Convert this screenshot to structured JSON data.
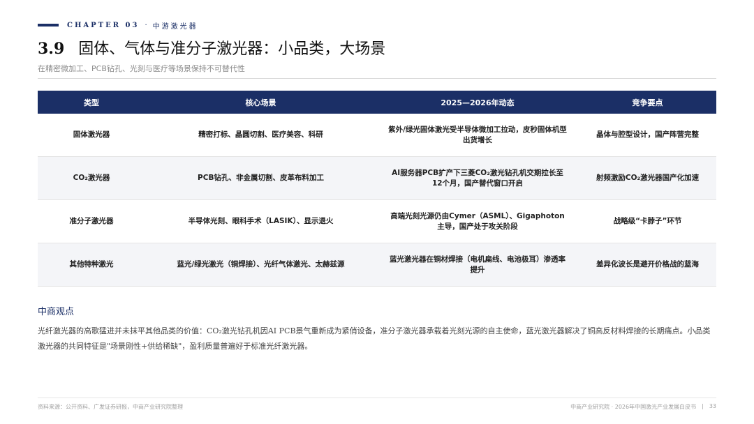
{
  "header": {
    "chapter": "CHAPTER 03",
    "chapter_sep": "·",
    "chapter_sub": "中游激光器",
    "title_num": "3.9",
    "title": "固体、气体与准分子激光器：小品类，大场景",
    "subtitle": "在精密微加工、PCB钻孔、光刻与医疗等场景保持不可替代性"
  },
  "table": {
    "headers": [
      "类型",
      "核心场景",
      "2025—2026年动态",
      "竞争要点"
    ],
    "rows": [
      [
        "固体激光器",
        "精密打标、晶圆切割、医疗美容、科研",
        "紫外/绿光固体激光受半导体微加工拉动，皮秒固体机型出货增长",
        "晶体与腔型设计，国产阵营完整"
      ],
      [
        "CO₂激光器",
        "PCB钻孔、非金属切割、皮革布料加工",
        "AI服务器PCB扩产下三菱CO₂激光钻孔机交期拉长至12个月，国产替代窗口开启",
        "射频激励CO₂激光器国产化加速"
      ],
      [
        "准分子激光器",
        "半导体光刻、眼科手术（LASIK）、显示退火",
        "高端光刻光源仍由Cymer（ASML）、Gigaphoton主导，国产处于攻关阶段",
        "战略级“卡脖子”环节"
      ],
      [
        "其他特种激光",
        "蓝光/绿光激光（铜焊接）、光纤气体激光、太赫兹源",
        "蓝光激光器在铜材焊接（电机扁线、电池极耳）渗透率提升",
        "差异化波长是避开价格战的蓝海"
      ]
    ]
  },
  "viewpoint": {
    "title": "中商观点",
    "body": "光纤激光器的高歌猛进并未抹平其他品类的价值：CO₂激光钻孔机因AI PCB景气重新成为紧俏设备，准分子激光器承载着光刻光源的自主使命，蓝光激光器解决了铜高反材料焊接的长期痛点。小品类激光器的共同特征是\"场景刚性+供给稀缺\"，盈利质量普遍好于标准光纤激光器。"
  },
  "footer": {
    "source": "资料来源：公开资料、广发证券研报，中商产业研究院整理",
    "org": "中商产业研究院 · 2026年中国激光产业发展白皮书",
    "sep": "|",
    "page": "33"
  }
}
